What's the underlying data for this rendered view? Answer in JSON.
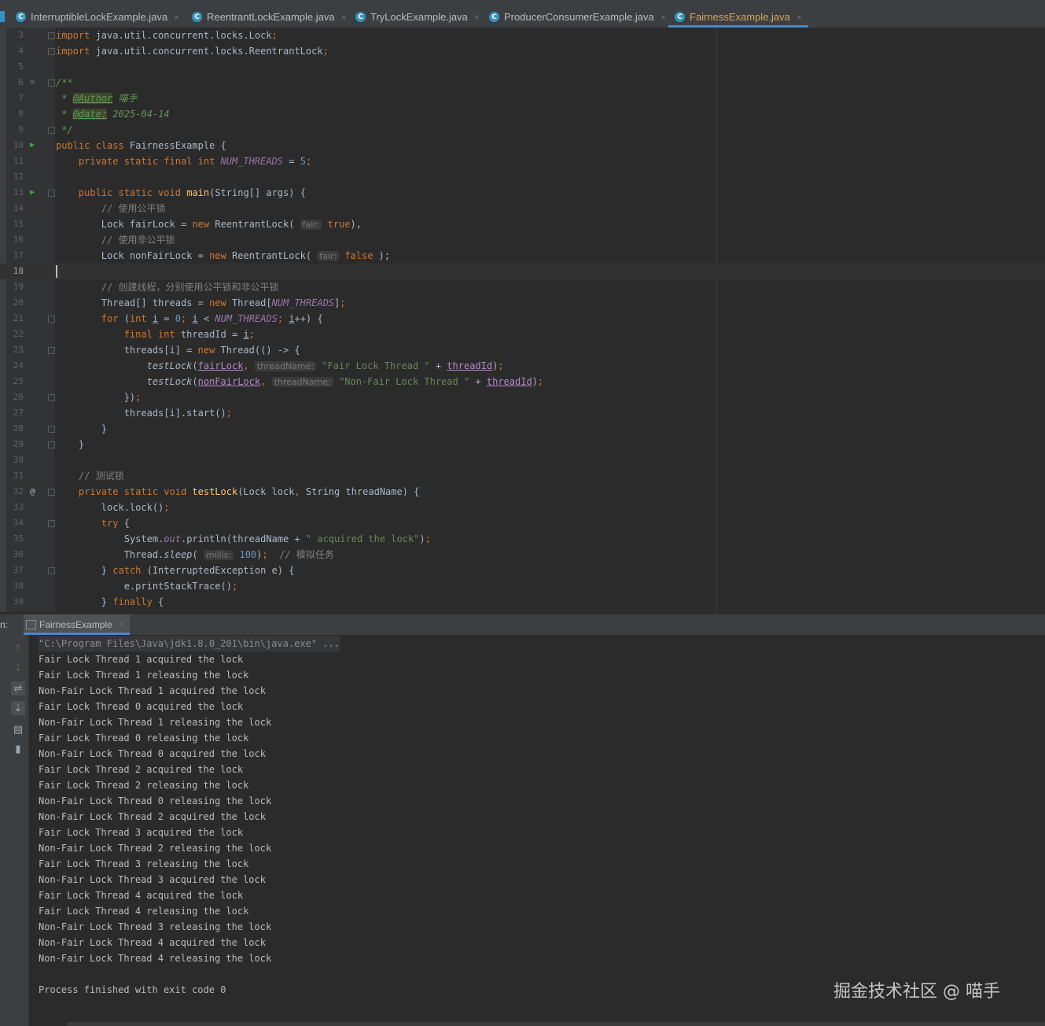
{
  "tabs": [
    {
      "label": "InterruptibleLockExample.java",
      "active": false
    },
    {
      "label": "ReentrantLockExample.java",
      "active": false
    },
    {
      "label": "TryLockExample.java",
      "active": false
    },
    {
      "label": "ProducerConsumerExample.java",
      "active": false
    },
    {
      "label": "FairnessExample.java",
      "active": true
    }
  ],
  "tab_icon_letter": "C",
  "close_glyph": "×",
  "editor": {
    "current_line": 18,
    "lines": [
      {
        "n": "3",
        "segs": [
          [
            "kw",
            "import "
          ],
          [
            "",
            "java.util.concurrent.locks.Lock"
          ],
          [
            "kw",
            ";"
          ]
        ]
      },
      {
        "n": "4",
        "segs": [
          [
            "kw",
            "import "
          ],
          [
            "",
            "java.util.concurrent.locks.ReentrantLock"
          ],
          [
            "kw",
            ";"
          ]
        ]
      },
      {
        "n": "5",
        "segs": []
      },
      {
        "n": "6",
        "segs": [
          [
            "doc",
            "/**"
          ]
        ]
      },
      {
        "n": "7",
        "segs": [
          [
            "doc",
            " * "
          ],
          [
            "tag",
            "@Author"
          ],
          [
            "doc",
            " 喵手"
          ]
        ]
      },
      {
        "n": "8",
        "segs": [
          [
            "doc",
            " * "
          ],
          [
            "tag",
            "@date:"
          ],
          [
            "doc",
            " 2025-04-14"
          ]
        ]
      },
      {
        "n": "9",
        "segs": [
          [
            "doc",
            " */"
          ]
        ]
      },
      {
        "n": "10",
        "segs": [
          [
            "kw",
            "public class "
          ],
          [
            "",
            "FairnessExample {"
          ]
        ]
      },
      {
        "n": "11",
        "segs": [
          [
            "",
            "    "
          ],
          [
            "kw",
            "private static final int "
          ],
          [
            "cst",
            "NUM_THREADS"
          ],
          [
            "",
            " = "
          ],
          [
            "num",
            "5"
          ],
          [
            "kw",
            ";"
          ]
        ]
      },
      {
        "n": "12",
        "segs": []
      },
      {
        "n": "13",
        "segs": [
          [
            "",
            "    "
          ],
          [
            "kw",
            "public static void "
          ],
          [
            "fn",
            "main"
          ],
          [
            "",
            "(String[] args) {"
          ]
        ]
      },
      {
        "n": "14",
        "segs": [
          [
            "",
            "        "
          ],
          [
            "cm",
            "// 使用公平锁"
          ]
        ]
      },
      {
        "n": "15",
        "segs": [
          [
            "",
            "        Lock fairLock = "
          ],
          [
            "kw",
            "new "
          ],
          [
            "",
            "ReentrantLock( "
          ],
          [
            "hint",
            "fair:"
          ],
          [
            "kw",
            " true"
          ],
          [
            "",
            "),"
          ],
          [
            "kw",
            ""
          ]
        ]
      },
      {
        "n": "16",
        "segs": [
          [
            "",
            "        "
          ],
          [
            "cm",
            "// 使用非公平锁"
          ]
        ]
      },
      {
        "n": "17",
        "segs": [
          [
            "",
            "        Lock nonFairLock = "
          ],
          [
            "kw",
            "new "
          ],
          [
            "",
            "ReentrantLock( "
          ],
          [
            "hint",
            "fair:"
          ],
          [
            "kw",
            " false"
          ],
          [
            "",
            " );"
          ]
        ]
      },
      {
        "n": "18",
        "segs": []
      },
      {
        "n": "19",
        "segs": [
          [
            "",
            "        "
          ],
          [
            "cm",
            "// 创建线程，分别使用公平锁和非公平锁"
          ]
        ]
      },
      {
        "n": "20",
        "segs": [
          [
            "",
            "        Thread[] threads = "
          ],
          [
            "kw",
            "new "
          ],
          [
            "",
            "Thread["
          ],
          [
            "cst",
            "NUM_THREADS"
          ],
          [
            "",
            "]"
          ],
          [
            "kw",
            ";"
          ]
        ]
      },
      {
        "n": "21",
        "segs": [
          [
            "",
            "        "
          ],
          [
            "kw",
            "for "
          ],
          [
            "",
            "("
          ],
          [
            "kw",
            "int "
          ],
          [
            "ul",
            "i"
          ],
          [
            "",
            " = "
          ],
          [
            "num",
            "0"
          ],
          [
            "kw",
            "; "
          ],
          [
            "ul",
            "i"
          ],
          [
            "",
            " < "
          ],
          [
            "cst",
            "NUM_THREADS"
          ],
          [
            "kw",
            "; "
          ],
          [
            "ul",
            "i"
          ],
          [
            "",
            "++) {"
          ]
        ]
      },
      {
        "n": "22",
        "segs": [
          [
            "",
            "            "
          ],
          [
            "kw",
            "final int "
          ],
          [
            "",
            "threadId = "
          ],
          [
            "ul",
            "i"
          ],
          [
            "kw",
            ";"
          ]
        ]
      },
      {
        "n": "23",
        "segs": [
          [
            "",
            "            threads[i] = "
          ],
          [
            "kw",
            "new "
          ],
          [
            "",
            "Thread(() -> {"
          ]
        ]
      },
      {
        "n": "24",
        "segs": [
          [
            "",
            "                "
          ],
          [
            "sfn",
            "testLock"
          ],
          [
            "",
            "("
          ],
          [
            "purp",
            "fairLock"
          ],
          [
            "kw",
            ","
          ],
          [
            "",
            " "
          ],
          [
            "hint",
            "threadName:"
          ],
          [
            "str",
            " \"Fair Lock Thread \""
          ],
          [
            "",
            " + "
          ],
          [
            "purp",
            "threadId"
          ],
          [
            "",
            ")"
          ],
          [
            "kw",
            ";"
          ]
        ]
      },
      {
        "n": "25",
        "segs": [
          [
            "",
            "                "
          ],
          [
            "sfn",
            "testLock"
          ],
          [
            "",
            "("
          ],
          [
            "purp",
            "nonFairLock"
          ],
          [
            "kw",
            ","
          ],
          [
            "",
            " "
          ],
          [
            "hint",
            "threadName:"
          ],
          [
            "str",
            " \"Non-Fair Lock Thread \""
          ],
          [
            "",
            " + "
          ],
          [
            "purp",
            "threadId"
          ],
          [
            "",
            ")"
          ],
          [
            "kw",
            ";"
          ]
        ]
      },
      {
        "n": "26",
        "segs": [
          [
            "",
            "            })"
          ],
          [
            "kw",
            ";"
          ]
        ]
      },
      {
        "n": "27",
        "segs": [
          [
            "",
            "            threads[i].start()"
          ],
          [
            "kw",
            ";"
          ]
        ]
      },
      {
        "n": "28",
        "segs": [
          [
            "",
            "        }"
          ]
        ]
      },
      {
        "n": "29",
        "segs": [
          [
            "",
            "    }"
          ]
        ]
      },
      {
        "n": "30",
        "segs": []
      },
      {
        "n": "31",
        "segs": [
          [
            "",
            "    "
          ],
          [
            "cm",
            "// 测试锁"
          ]
        ]
      },
      {
        "n": "32",
        "segs": [
          [
            "",
            "    "
          ],
          [
            "kw",
            "private static void "
          ],
          [
            "fn",
            "testLock"
          ],
          [
            "",
            "(Lock lock"
          ],
          [
            "kw",
            ", "
          ],
          [
            "",
            "String threadName) {"
          ]
        ]
      },
      {
        "n": "33",
        "segs": [
          [
            "",
            "        lock.lock()"
          ],
          [
            "kw",
            ";"
          ]
        ]
      },
      {
        "n": "34",
        "segs": [
          [
            "",
            "        "
          ],
          [
            "kw",
            "try "
          ],
          [
            "",
            "{"
          ]
        ]
      },
      {
        "n": "35",
        "segs": [
          [
            "",
            "            System."
          ],
          [
            "fld",
            "out"
          ],
          [
            "",
            ".println(threadName + "
          ],
          [
            "str",
            "\" acquired the lock\""
          ],
          [
            "",
            ")"
          ],
          [
            "kw",
            ";"
          ]
        ]
      },
      {
        "n": "36",
        "segs": [
          [
            "",
            "            Thread."
          ],
          [
            "sfn",
            "sleep"
          ],
          [
            "",
            "( "
          ],
          [
            "hint",
            "millis:"
          ],
          [
            "num",
            " 100"
          ],
          [
            "",
            ")"
          ],
          [
            "kw",
            ";"
          ],
          [
            "",
            "  "
          ],
          [
            "cm",
            "// 模拟任务"
          ]
        ]
      },
      {
        "n": "37",
        "segs": [
          [
            "",
            "        } "
          ],
          [
            "kw",
            "catch "
          ],
          [
            "",
            "(InterruptedException e) {"
          ]
        ]
      },
      {
        "n": "38",
        "segs": [
          [
            "",
            "            e.printStackTrace()"
          ],
          [
            "kw",
            ";"
          ]
        ]
      },
      {
        "n": "39",
        "segs": [
          [
            "",
            "        } "
          ],
          [
            "kw",
            "finally "
          ],
          [
            "",
            "{"
          ]
        ]
      }
    ]
  },
  "run": {
    "label": "n:",
    "tab": "FairnessExample",
    "output": [
      "\"C:\\Program Files\\Java\\jdk1.8.0_201\\bin\\java.exe\" ...",
      "Fair Lock Thread 1 acquired the lock",
      "Fair Lock Thread 1 releasing the lock",
      "Non-Fair Lock Thread 1 acquired the lock",
      "Fair Lock Thread 0 acquired the lock",
      "Non-Fair Lock Thread 1 releasing the lock",
      "Fair Lock Thread 0 releasing the lock",
      "Non-Fair Lock Thread 0 acquired the lock",
      "Fair Lock Thread 2 acquired the lock",
      "Fair Lock Thread 2 releasing the lock",
      "Non-Fair Lock Thread 0 releasing the lock",
      "Non-Fair Lock Thread 2 acquired the lock",
      "Fair Lock Thread 3 acquired the lock",
      "Non-Fair Lock Thread 2 releasing the lock",
      "Fair Lock Thread 3 releasing the lock",
      "Non-Fair Lock Thread 3 acquired the lock",
      "Fair Lock Thread 4 acquired the lock",
      "Fair Lock Thread 4 releasing the lock",
      "Non-Fair Lock Thread 3 releasing the lock",
      "Non-Fair Lock Thread 4 acquired the lock",
      "Non-Fair Lock Thread 4 releasing the lock",
      "",
      "Process finished with exit code 0"
    ],
    "toolbar_icons": [
      "up-arrow-icon",
      "down-arrow-icon",
      "soft-wrap-icon",
      "scroll-to-end-icon",
      "print-icon",
      "trash-icon"
    ]
  },
  "watermark": "掘金技术社区 @ 喵手"
}
